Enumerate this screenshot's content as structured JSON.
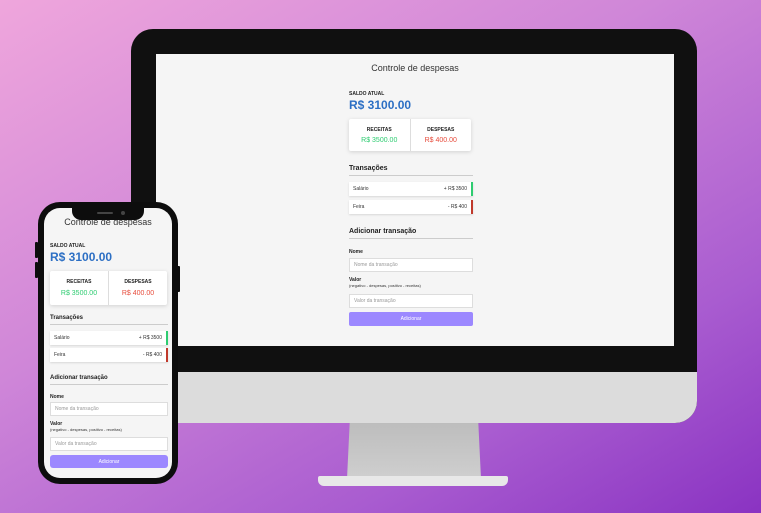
{
  "app": {
    "title": "Controle de despesas",
    "balance_label": "SALDO ATUAL",
    "balance_value": "R$ 3100.00",
    "summary": {
      "income_label": "RECEITAS",
      "income_value": "R$ 3500.00",
      "expense_label": "DESPESAS",
      "expense_value": "R$ 400.00"
    },
    "transactions_title": "Transações",
    "transactions": [
      {
        "name": "Salário",
        "amount": "+ R$ 3500",
        "type": "income"
      },
      {
        "name": "Feira",
        "amount": "- R$ 400",
        "type": "expense"
      }
    ],
    "add_title": "Adicionar transação",
    "name_label": "Nome",
    "name_placeholder": "Nome da transação",
    "value_label": "Valor",
    "value_hint": "(negativo - despesas, positivo - receitas)",
    "value_placeholder": "Valor da transação",
    "add_button": "Adicionar"
  },
  "colors": {
    "accent": "#9c88ff",
    "balance": "#2c6fc4",
    "income": "#2ecc71",
    "expense": "#e74c3c"
  }
}
